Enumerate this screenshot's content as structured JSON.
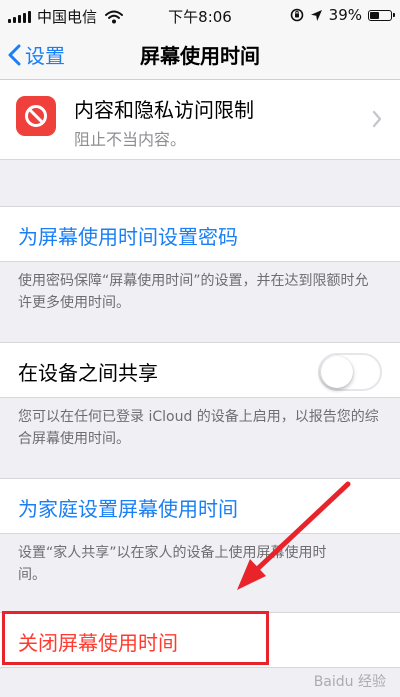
{
  "status_bar": {
    "carrier": "中国电信",
    "time": "下午8:06",
    "battery_percent": "39%",
    "battery_level": 0.39
  },
  "nav": {
    "back_label": "设置",
    "title": "屏幕使用时间"
  },
  "restrictions": {
    "title": "内容和隐私访问限制",
    "subtitle": "阻止不当内容。"
  },
  "passcode": {
    "label": "为屏幕使用时间设置密码",
    "footnote": "使用密码保障“屏幕使用时间”的设置，并在达到限额时允许更多使用时间。"
  },
  "share": {
    "label": "在设备之间共享",
    "toggle_on": false,
    "footnote": "您可以在任何已登录 iCloud 的设备上启用，以报告您的综合屏幕使用时间。"
  },
  "family": {
    "label": "为家庭设置屏幕使用时间",
    "footnote": "设置“家人共享”以在家人的设备上使用屏幕使用时间。"
  },
  "turn_off": {
    "label": "关闭屏幕使用时间"
  },
  "watermark": "Baidu 经验",
  "colors": {
    "accent_blue": "#1a7ff5",
    "destructive_red": "#ff3b30",
    "annotation_red": "#e8232a",
    "background": "#efeff4"
  }
}
